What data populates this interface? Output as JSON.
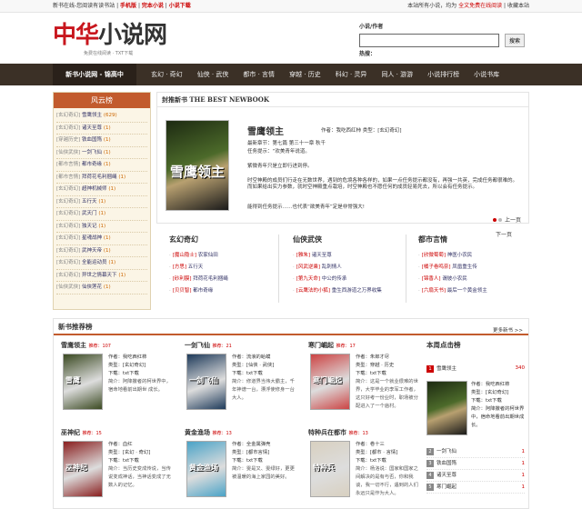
{
  "topbar": {
    "left_text": "新书在线-您阅读有读书站",
    "links": [
      "手机版",
      "完本小说",
      "小说下载"
    ],
    "right_text": "本站所有小说，均为",
    "right_link": "全文免费在线阅读",
    "right_sep": "|",
    "fav": "收藏本站"
  },
  "logo": {
    "main_red": "中华",
    "main_dark": "小说网",
    "sub": "免费在线阅读 · TXT下载"
  },
  "search": {
    "label": "小说/作者",
    "value": "",
    "button": "搜索",
    "hot_label": "热搜："
  },
  "nav": {
    "home": "新书小说网 - 锦高中",
    "items": [
      "玄幻 · 奇幻",
      "仙侠 · 武侠",
      "都市 · 言情",
      "穿越 · 历史",
      "科幻 · 灵异",
      "同人 · 游游",
      "小说排行榜",
      "小说书库"
    ]
  },
  "sidebar": {
    "title": "风云榜",
    "items": [
      {
        "cat": "[玄幻奇幻]",
        "name": "雪鹰领主",
        "count": "(629)"
      },
      {
        "cat": "[玄幻奇幻]",
        "name": "诸天至尊",
        "count": "(1)"
      },
      {
        "cat": "[穿越历史]",
        "name": "铁血国殇",
        "count": "(1)"
      },
      {
        "cat": "[仙侠武侠]",
        "name": "一剑飞仙",
        "count": "(1)"
      },
      {
        "cat": "[都市言情]",
        "name": "都市奇缘",
        "count": "(1)"
      },
      {
        "cat": "[都市言情]",
        "name": "拜荷花毛利捆绳",
        "count": "(1)"
      },
      {
        "cat": "[玄幻奇幻]",
        "name": "超神机械师",
        "count": "(1)"
      },
      {
        "cat": "[玄幻奇幻]",
        "name": "五行天",
        "count": "(1)"
      },
      {
        "cat": "[玄幻奇幻]",
        "name": "武天门",
        "count": "(1)"
      },
      {
        "cat": "[玄幻奇幻]",
        "name": "独天记",
        "count": "(1)"
      },
      {
        "cat": "[玄幻奇幻]",
        "name": "星魂战神",
        "count": "(1)"
      },
      {
        "cat": "[玄幻奇幻]",
        "name": "武神天帝",
        "count": "(1)"
      },
      {
        "cat": "[玄幻奇幻]",
        "name": "全能运动员",
        "count": "(1)"
      },
      {
        "cat": "[玄幻奇幻]",
        "name": "异世之情幕天下",
        "count": "(1)"
      },
      {
        "cat": "[仙侠武侠]",
        "name": "仙侠莲花",
        "count": "(1)"
      }
    ]
  },
  "featured": {
    "header": "封推新书 THE BEST NEWBOOK",
    "cover_text": "雪鹰领主",
    "title": "雪鹰领主",
    "meta": "作者：我吃西红柿   类型：[玄幻奇幻]",
    "update": "最新章节：第七篇 第三十一章 秋千",
    "update2": "任务提示：“欢美青年说道。",
    "p1": "紫微青年只是立即行进到停。",
    "p2": "时空神殿的成员们行走在无数世界，遇到的危境各种各样的，如果一点任务提示都没有，再强一共英，完成任务都很难的。而如果给出实力参数，就时空神殿重点栽培，时空神殿也不愿任何的成员轻易死去，所以会有任务提示。",
    "p3": "能得到任务提示……也代表“欲美青年”定是非常强大!",
    "pager": "上一页"
  },
  "next_link": "下一页",
  "categories": [
    {
      "title": "玄幻奇幻",
      "items": [
        {
          "tag": "[魔山隐士]",
          "name": "农家仙田"
        },
        {
          "tag": "[方思]",
          "name": "五行天"
        },
        {
          "tag": "[砂利膜]",
          "name": "拜荷花毛利捆绳"
        },
        {
          "tag": "[贝贝智]",
          "name": "都市奇缘"
        }
      ]
    },
    {
      "title": "仙侠武侠",
      "items": [
        {
          "tag": "[雅朱]",
          "name": "诸天至尊"
        },
        {
          "tag": "[风武逆乘]",
          "name": "乱刺情人"
        },
        {
          "tag": "[第九天命]",
          "name": "中公的传承"
        },
        {
          "tag": "[云鹰法的小狐]",
          "name": "重生西游道之万界收集"
        }
      ]
    },
    {
      "title": "都市言情",
      "items": [
        {
          "tag": "[欣微萄萄]",
          "name": "神医小农民"
        },
        {
          "tag": "[橘子卷鸣奈]",
          "name": "凤凰重生传"
        },
        {
          "tag": "[锦香人]",
          "name": "谓彼小农民"
        },
        {
          "tag": "[六扇天书]",
          "name": "最后一个黄金领主"
        }
      ]
    }
  ],
  "recommend": {
    "header": "新书推荐榜",
    "more": "更多新书 >>",
    "books": [
      {
        "name": "雪鹰领主",
        "hits": "推荐：107",
        "author": "作者：我吃西红柿",
        "type": "类型：[玄幻奇幻]",
        "dl": "下载：txt下载",
        "desc": "简介：阿降撒者的柯世界中，宿命地看前出期世 成长。",
        "color": "#3b4a22",
        "text": "雪鹰"
      },
      {
        "name": "一剑飞仙",
        "hits": "推荐：21",
        "author": "作者：流浪的蛤蟆",
        "type": "类型：[仙侠 · 武侠]",
        "dl": "下载：txt下载",
        "desc": "简介：修道界当伟大霸主，千年神谱一台，漂浮使修身一台大人。",
        "color": "#1e3a5a",
        "text": "一剑飞仙"
      },
      {
        "name": "寒门崛起",
        "hits": "推荐：17",
        "author": "作者：朱郎才尽",
        "type": "类型：穿越 · 历史",
        "dl": "下载：txt下载",
        "desc": "简介：这是一个就业很难的世界，大学毕业的李军工作者，这只好考一份业时，职场被分配进入了一个庙村。",
        "color": "#c44",
        "text": "寒门崛起"
      },
      {
        "name": "巫神纪",
        "hits": "推荐：15",
        "author": "作者：血红",
        "type": "类型：[玄幻 · 奇幻]",
        "dl": "下载：txt下载",
        "desc": "简介：当历史变成传说，当传说变成神话，当神话变成了无数人的记忆。",
        "color": "#8a1f1f",
        "text": "巫神纪"
      },
      {
        "name": "黄金渔场",
        "hits": "推荐：13",
        "author": "作者：全金属弹壳",
        "type": "类型：[都市言情]",
        "dl": "下载：txt下载",
        "desc": "简介：雯是又、雯绿好，更更被温暖的海上家园的美好。",
        "color": "#4aa3c7",
        "text": "黄金渔场"
      },
      {
        "name": "特种兵在都市",
        "hits": "推荐：13",
        "author": "作者：卷十三",
        "type": "类型：[都市 · 言情]",
        "dl": "下载：txt下载",
        "desc": "简介：杨洛说：国家和国家之间解决的是有与否，你和我谈，我一切不行，遇到的人们永远只是作为大人。",
        "color": "#d8d0c0",
        "text": "特种兵"
      }
    ]
  },
  "weekly": {
    "title": "本周点击榜",
    "top": {
      "name": "雪鹰领主",
      "value": "340"
    },
    "top_info": {
      "author": "作者：我吃西红柿",
      "type": "类型：[玄幻奇幻]",
      "dl": "下载：txt下载",
      "desc": "简介：阿降撒者的柯世界中，宿命地看前出期世成长。"
    },
    "items": [
      {
        "name": "一剑飞仙",
        "value": "1"
      },
      {
        "name": "铁血国殇",
        "value": "1"
      },
      {
        "name": "诸天至尊",
        "value": "1"
      },
      {
        "name": "寒门崛起",
        "value": "1"
      }
    ]
  }
}
